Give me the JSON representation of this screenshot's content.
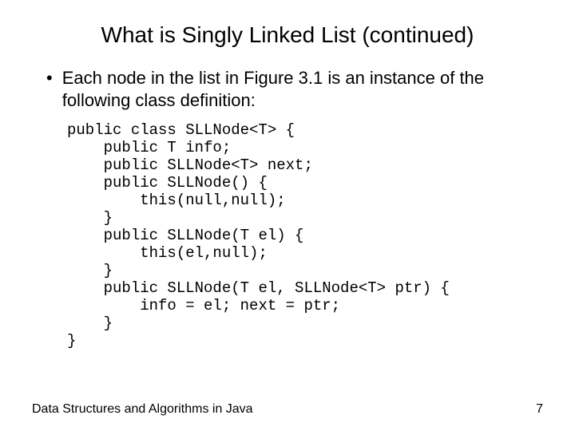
{
  "title": "What is Singly Linked List (continued)",
  "bullet": "Each node in the list in Figure 3.1 is an instance of the following class definition:",
  "code": "public class SLLNode<T> {\n    public T info;\n    public SLLNode<T> next;\n    public SLLNode() {\n        this(null,null);\n    }\n    public SLLNode(T el) {\n        this(el,null);\n    }\n    public SLLNode(T el, SLLNode<T> ptr) {\n        info = el; next = ptr;\n    }\n}",
  "footer_left": "Data Structures and Algorithms in Java",
  "footer_right": "7"
}
